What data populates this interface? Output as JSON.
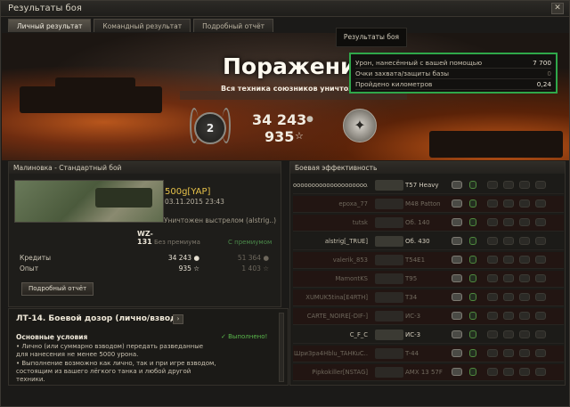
{
  "window": {
    "title": "Результаты боя",
    "close_glyph": "✕"
  },
  "tabs": [
    {
      "label": "Личный результат",
      "active": true
    },
    {
      "label": "Командный результат",
      "active": false
    },
    {
      "label": "Подробный отчёт",
      "active": false
    }
  ],
  "banner": {
    "result": "Поражение",
    "subtitle": "Вся техника союзников уничтожена"
  },
  "tooltip_title": "Результаты боя",
  "tooltip": [
    {
      "label": "Урон, нанесённый с вашей помощью",
      "value": "7 700"
    },
    {
      "label": "Очки захвата/защиты базы",
      "value": "0"
    },
    {
      "label": "Пройдено километров",
      "value": "0,24"
    }
  ],
  "summary": {
    "medal_value": "2",
    "credits": "34 243",
    "credits_icon": "credits-icon",
    "experience": "935",
    "experience_glyph": "☆",
    "credits_glyph": "●",
    "badge_glyph": "✦"
  },
  "left_panel": {
    "title": "Малиновка - Стандартный бой",
    "tank_name": "WZ-131",
    "player": "500g[YAP]",
    "date": "03.11.2015 23:43",
    "death_reason": "Уничтожен выстрелом (alstrig..)",
    "col_no_premium": "Без премиума",
    "col_premium": "С премиумом",
    "rows": [
      {
        "label": "Кредиты",
        "value": "34 243 ●",
        "premium": "51 364 ●"
      },
      {
        "label": "Опыт",
        "value": "935 ☆",
        "premium": "1 403 ☆"
      }
    ],
    "details_button": "Подробный отчёт"
  },
  "mission": {
    "title": "ЛТ-14. Боевой дозор (лично/взвод)",
    "arrow": "›",
    "conditions_label": "Основные условия",
    "status": "✓ Выполнено!",
    "body": [
      "• Лично (или суммарно взводом) передать разведанные",
      "для нанесения не менее 5000 урона.",
      "• Выполнение возможно как лично, так и при игре взводом,",
      "состоящим из вашего лёгкого танка и любой другой",
      "техники."
    ]
  },
  "right_panel": {
    "title": "Боевая эффективность",
    "rows": [
      {
        "name": "oooooooooooooooooooo..",
        "vehicle": "T57 Heavy",
        "dim": false
      },
      {
        "name": "epoxa_77",
        "vehicle": "M48 Patton",
        "dim": true
      },
      {
        "name": "tutsk",
        "vehicle": "Об. 140",
        "dim": true
      },
      {
        "name": "alstrig[_TRUE]",
        "vehicle": "Об. 430",
        "dim": false
      },
      {
        "name": "valerik_853",
        "vehicle": "T54E1",
        "dim": true
      },
      {
        "name": "MamontKS",
        "vehicle": "T95",
        "dim": true
      },
      {
        "name": "XUMUK5tina[E4RTH]",
        "vehicle": "T34",
        "dim": true
      },
      {
        "name": "CARTE_NOIRE[-DIF-]",
        "vehicle": "ИС-3",
        "dim": true
      },
      {
        "name": "C_F_C",
        "vehicle": "ИС-3",
        "dim": false
      },
      {
        "name": "Шри3ра4Hblu_TAHKuC..",
        "vehicle": "T-44",
        "dim": true
      },
      {
        "name": "Pipkokiller[NSTAG]",
        "vehicle": "AMX 13 57F",
        "dim": true
      }
    ]
  }
}
